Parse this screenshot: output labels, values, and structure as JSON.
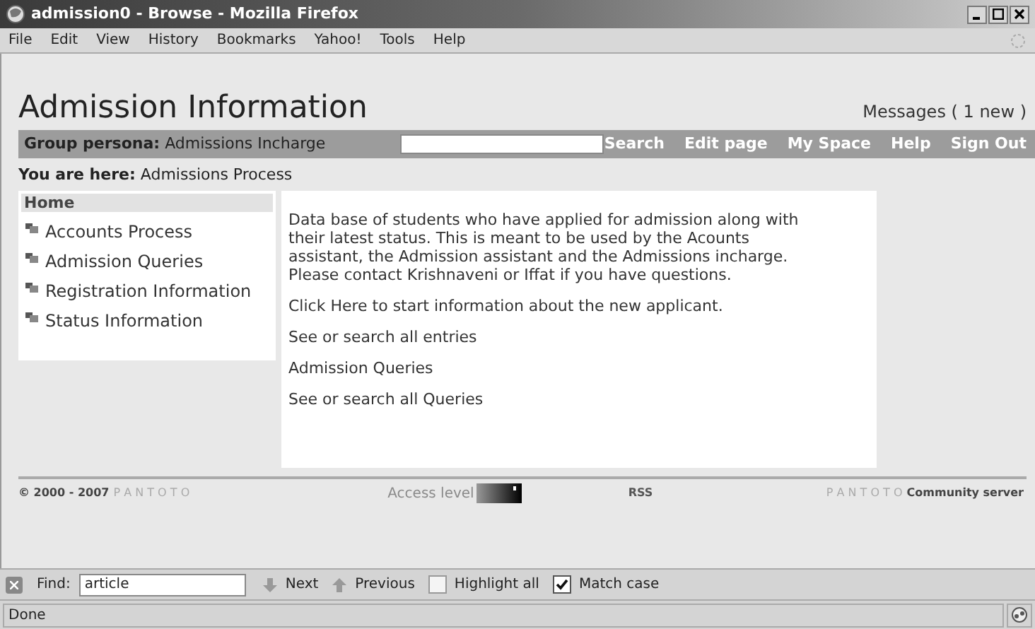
{
  "window": {
    "title": "admission0 - Browse - Mozilla Firefox"
  },
  "menu": [
    "File",
    "Edit",
    "View",
    "History",
    "Bookmarks",
    "Yahoo!",
    "Tools",
    "Help"
  ],
  "header": {
    "title": "Admission Information",
    "messages": "Messages ( 1 new )"
  },
  "navbar": {
    "persona_label": "Group persona:",
    "persona": "Admissions Incharge",
    "links": [
      "Search",
      "Edit page",
      "My Space",
      "Help",
      "Sign Out"
    ]
  },
  "breadcrumb": {
    "label": "You are here:",
    "page": "Admissions Process"
  },
  "sidebar": {
    "heading": "Home",
    "items": [
      "Accounts Process",
      "Admission Queries",
      "Registration Information",
      "Status Information"
    ]
  },
  "content": {
    "description": "Data base of students who have applied for admission along with their latest status. This is meant to be used by the Acounts assistant, the Admission assistant and the Admissions incharge. Please contact Krishnaveni or Iffat if you have questions.",
    "links": [
      "Click Here to start information about the new applicant.",
      "See or search all entries",
      "Admission Queries",
      "See or search all Queries"
    ]
  },
  "footer": {
    "copyright": "© 2000 - 2007",
    "brand": "P A N T O T O",
    "access_label": "Access level",
    "rss": "RSS",
    "server_brand": "P A N T O T O",
    "server": "Community server"
  },
  "find_bar": {
    "label": "Find:",
    "value": "article",
    "next": "Next",
    "previous": "Previous",
    "options": [
      {
        "label": "Highlight all",
        "checked": false
      },
      {
        "label": "Match case",
        "checked": true
      }
    ]
  },
  "status_bar": {
    "text": "Done"
  }
}
